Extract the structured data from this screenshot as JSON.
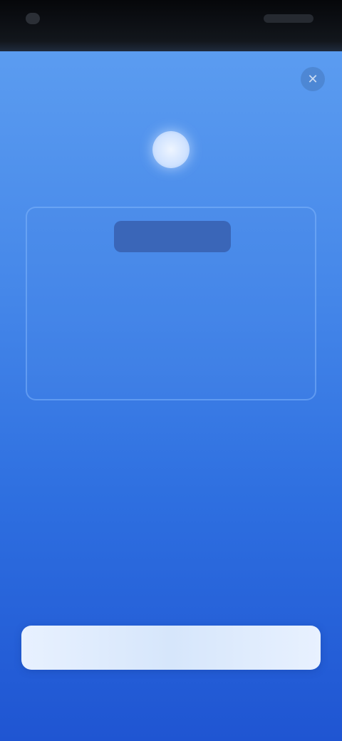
{
  "status_bar": {},
  "dialog": {
    "close_glyph": "✕"
  },
  "plan": {
    "badge": "",
    "price_line_1": "",
    "price_line_2": "",
    "price_subtext": "",
    "footnote": ""
  },
  "features": {
    "heading": "",
    "items": [
      "",
      "",
      ""
    ]
  },
  "actions": {
    "cta_label": "",
    "secondary_link": ""
  },
  "colors": {
    "background_top": "#5b9cf0",
    "background_bottom": "#1f55d2",
    "cta_background": "#e8f1ff"
  }
}
